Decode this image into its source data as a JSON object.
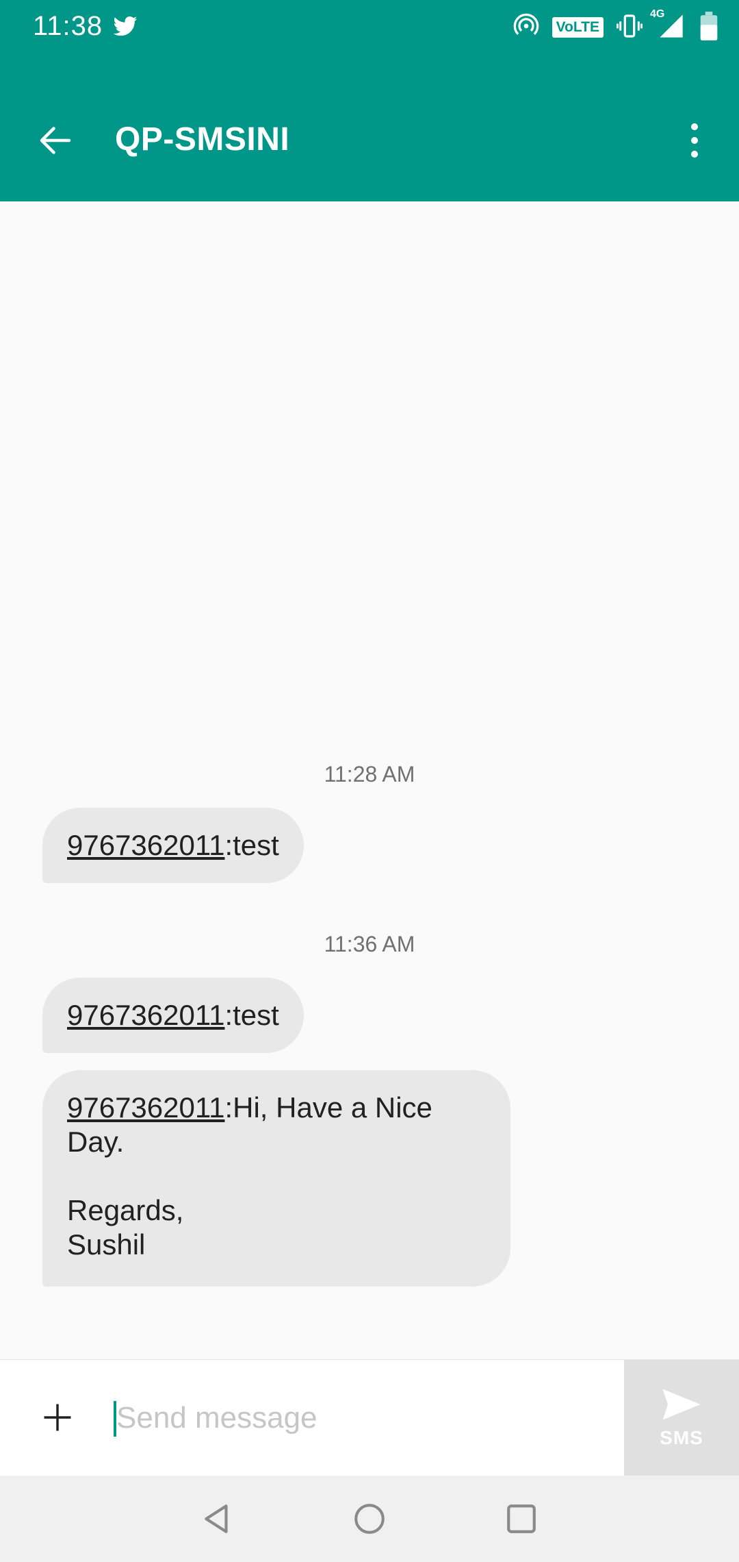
{
  "status_bar": {
    "time": "11:38",
    "volte": "VoLTE",
    "network": "4G",
    "icons": [
      "twitter-icon",
      "hotspot-icon",
      "vibrate-icon",
      "signal-icon",
      "battery-icon"
    ]
  },
  "toolbar": {
    "title": "QP-SMSINI",
    "back_icon": "arrow-back-icon",
    "menu_icon": "more-vert-icon"
  },
  "colors": {
    "primary": "#009688",
    "bubble": "#e8e8e8",
    "background": "#fafafa"
  },
  "messages": [
    {
      "timestamp": "11:28 AM",
      "items": [
        {
          "number": "9767362011",
          "text": ":test"
        }
      ]
    },
    {
      "timestamp": "11:36 AM",
      "items": [
        {
          "number": "9767362011",
          "text": ":test"
        },
        {
          "number": "9767362011",
          "text": ":Hi, Have a Nice",
          "line2": "Day.",
          "line3": "",
          "line4": "Regards,",
          "line5": "Sushil"
        }
      ]
    }
  ],
  "compose": {
    "placeholder": "Send message",
    "value": "",
    "send_label": "SMS",
    "attach_icon": "plus-icon",
    "send_icon": "send-icon"
  },
  "navigation": {
    "icons": [
      "back-triangle-icon",
      "home-circle-icon",
      "recents-square-icon"
    ]
  }
}
